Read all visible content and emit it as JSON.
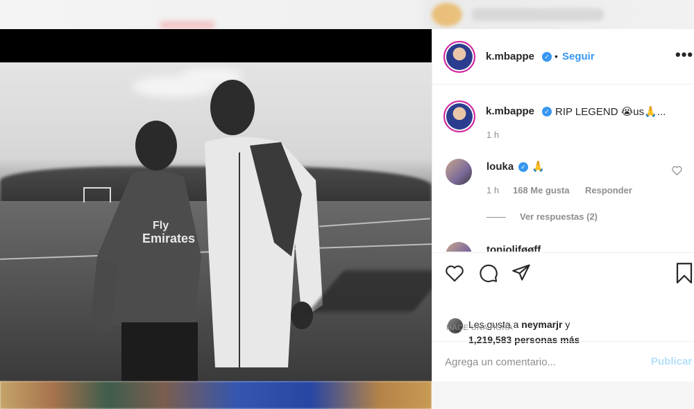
{
  "post": {
    "username": "k.mbappe",
    "follow_label": "Seguir",
    "separator": "•",
    "more_label": "•••",
    "caption": "RIP LEGEND 😭us🙏...",
    "caption_time": "1 h"
  },
  "photo": {
    "shirt_text_line1": "Fly",
    "shirt_text_line2": "Emirates"
  },
  "comments": [
    {
      "username": "louka",
      "text": "🙏",
      "time": "1 h",
      "likes": "168 Me gusta",
      "reply_label": "Responder",
      "view_replies": "Ver respuestas (2)"
    },
    {
      "username": "tonioliføøff",
      "text": "✓"
    }
  ],
  "likes": {
    "prefix": "Les gusta a",
    "user": "neymarjr",
    "suffix": "y",
    "count_text": "1,219,583 personas más"
  },
  "timestamp": "HACE UNA HORA",
  "comment_box": {
    "placeholder": "Agrega un comentario...",
    "publish_label": "Publicar"
  },
  "colors": {
    "link": "#3897f0",
    "muted": "#8e8e8e",
    "publish_disabled": "#b2dffc",
    "text": "#262626"
  }
}
